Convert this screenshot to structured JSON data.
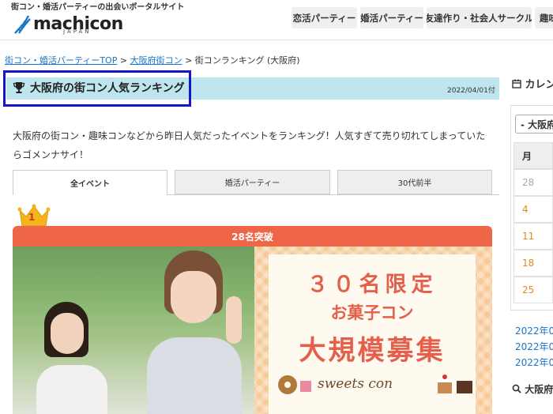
{
  "header": {
    "tagline": "街コン・婚活パーティーの出会いポータルサイト",
    "logo_text": "machicon",
    "logo_sub": "JAPAN",
    "nav": [
      "恋活パーティー",
      "婚活パーティー",
      "友達作り・社会人サークル",
      "趣味"
    ]
  },
  "breadcrumb": {
    "items": [
      "街コン・婚活パーティーTOP",
      "大阪府街コン",
      "街コンランキング (大阪府)"
    ],
    "separator": ">"
  },
  "page": {
    "title": "大阪府の街コン人気ランキング",
    "date": "2022/04/01付",
    "description": "大阪府の街コン・趣味コンなどから昨日人気だったイベントをランキング！人気すぎて売り切れてしまっていたらゴメンナサイ！"
  },
  "tabs": [
    "全イベント",
    "婚活パーティー",
    "30代前半"
  ],
  "ranking": [
    {
      "rank": "1",
      "badge": "28名突破",
      "banner": {
        "line1": "３０名限定",
        "line2": "お菓子コン",
        "line3": "大規模募集",
        "line4": "sweets con"
      }
    }
  ],
  "sidebar": {
    "calendar_title": "カレンダー",
    "month_select": "- 大阪府",
    "weekday_head": "月",
    "days": [
      "28",
      "4",
      "11",
      "18",
      "25"
    ],
    "links": [
      "2022年0",
      "2022年0",
      "2022年0"
    ],
    "search_title": "大阪府"
  },
  "colors": {
    "title_band": "#bfe6ee",
    "card_header": "#ef6548",
    "link": "#1a76c6",
    "highlight_box": "#1515d0",
    "crown": "#f4b41a"
  }
}
